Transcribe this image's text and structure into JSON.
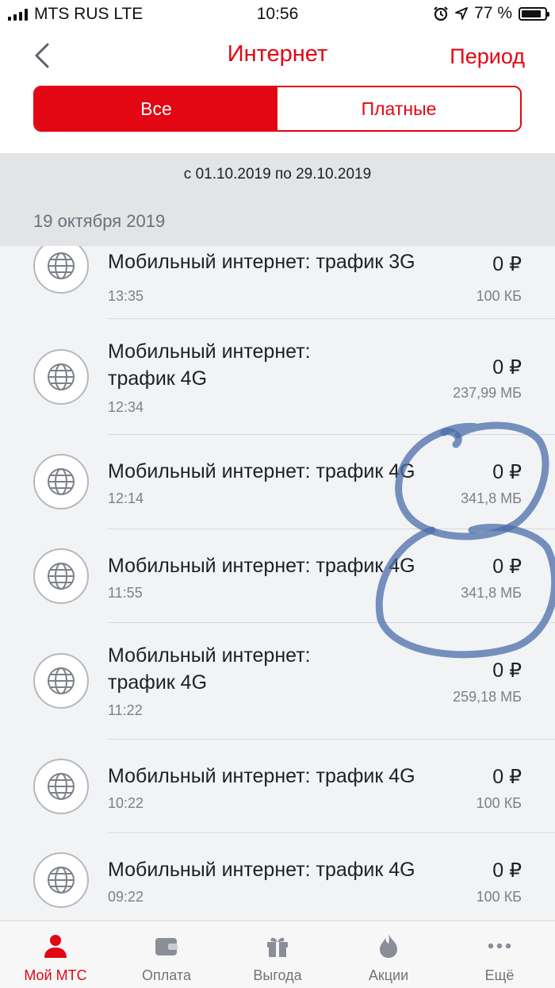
{
  "status_bar": {
    "carrier": "MTS RUS LTE",
    "time": "10:56",
    "battery": "77 %"
  },
  "nav": {
    "title": "Интернет",
    "period_button": "Период"
  },
  "segments": {
    "all": "Все",
    "paid": "Платные",
    "selected": "all"
  },
  "period_range": "с 01.10.2019 по 29.10.2019",
  "date_header": "19 октября 2019",
  "entries": [
    {
      "name": "Мобильный интернет: трафик 3G",
      "time": "13:35",
      "price": "0 ₽",
      "size": "100 КБ"
    },
    {
      "name": "Мобильный интернет: трафик 4G",
      "time": "12:34",
      "price": "0 ₽",
      "size": "237,99 МБ"
    },
    {
      "name": "Мобильный интернет: трафик 4G",
      "time": "12:14",
      "price": "0 ₽",
      "size": "341,8 МБ"
    },
    {
      "name": "Мобильный интернет: трафик 4G",
      "time": "11:55",
      "price": "0 ₽",
      "size": "341,8 МБ"
    },
    {
      "name": "Мобильный интернет: трафик 4G",
      "time": "11:22",
      "price": "0 ₽",
      "size": "259,18 МБ"
    },
    {
      "name": "Мобильный интернет: трафик 4G",
      "time": "10:22",
      "price": "0 ₽",
      "size": "100 КБ"
    },
    {
      "name": "Мобильный интернет: трафик 4G",
      "time": "09:22",
      "price": "0 ₽",
      "size": "100 КБ"
    }
  ],
  "tabbar": [
    {
      "label": "Мой МТС",
      "icon": "person-icon",
      "active": true
    },
    {
      "label": "Оплата",
      "icon": "wallet-icon",
      "active": false
    },
    {
      "label": "Выгода",
      "icon": "gift-icon",
      "active": false
    },
    {
      "label": "Акции",
      "icon": "flame-icon",
      "active": false
    },
    {
      "label": "Ещё",
      "icon": "more-dots-icon",
      "active": false
    }
  ],
  "colors": {
    "accent": "#e30613",
    "scribble": "#4a6ea8"
  }
}
